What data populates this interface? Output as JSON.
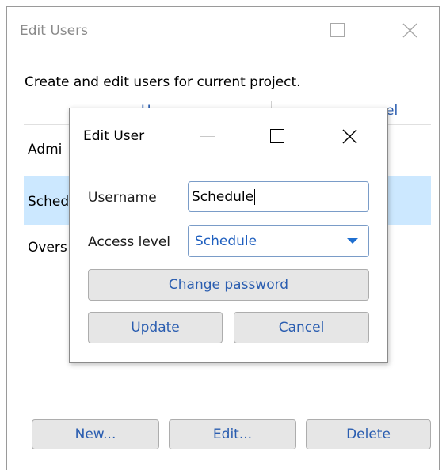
{
  "outer_window": {
    "title": "Edit Users",
    "description": "Create and edit users for current project.",
    "columns": [
      "Username",
      "Access level"
    ],
    "rows": [
      {
        "partial_name": "Admi",
        "selected": false
      },
      {
        "partial_name": "Sched",
        "selected": true
      },
      {
        "partial_name": "Overs",
        "selected": false
      }
    ],
    "buttons": {
      "new": "New...",
      "edit": "Edit...",
      "delete": "Delete"
    },
    "visible_header_fragments": {
      "col1": "U",
      "col2": "el"
    }
  },
  "dialog": {
    "title": "Edit User",
    "username_label": "Username",
    "username_value": "Schedule",
    "access_label": "Access level",
    "access_value": "Schedule",
    "change_password": "Change password",
    "update": "Update",
    "cancel": "Cancel"
  },
  "colors": {
    "selection": "#cce8ff",
    "link_text": "#2a5db0",
    "field_border": "#7a9cc8",
    "dropdown_arrow": "#1f6fd0"
  }
}
